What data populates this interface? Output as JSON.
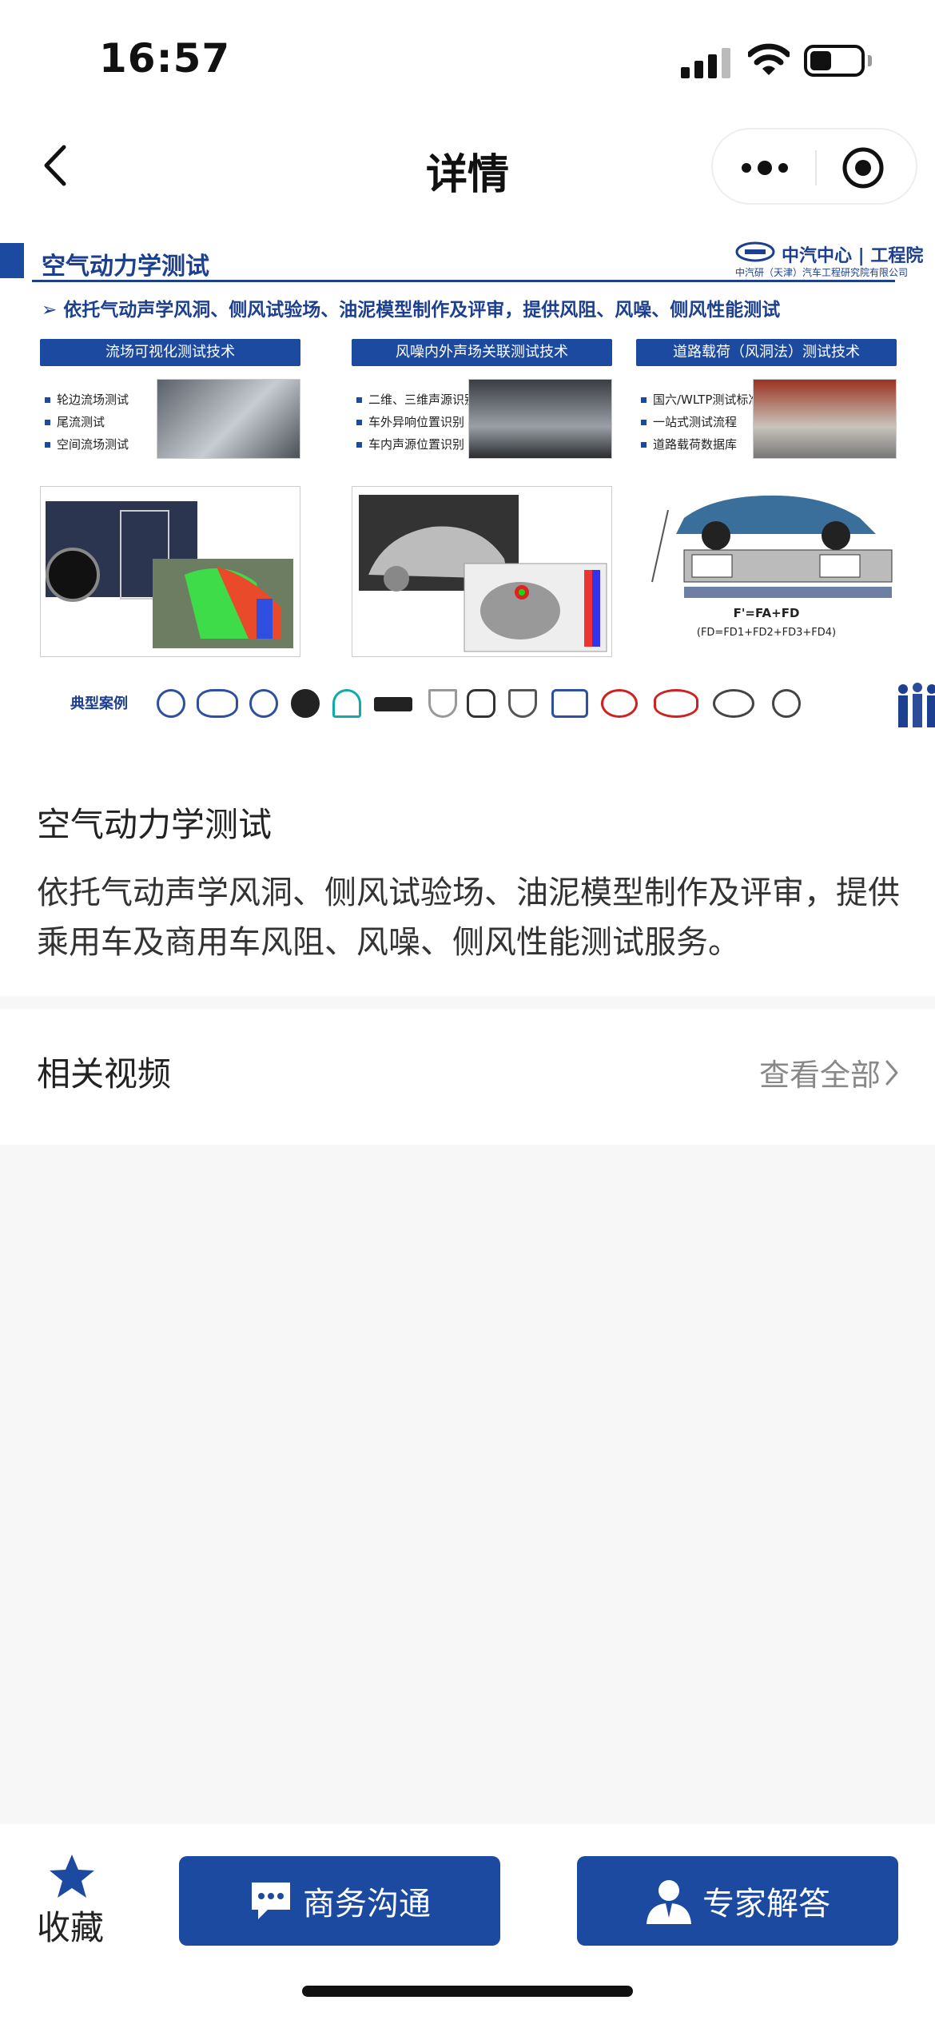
{
  "status_bar": {
    "time": "16:57"
  },
  "nav": {
    "title": "详情"
  },
  "banner": {
    "title": "空气动力学测试",
    "logo_text": "中汽中心 | 工程院",
    "logo_sub": "中汽研（天津）汽车工程研究院有限公司",
    "subtitle": "➢ 依托气动声学风洞、侧风试验场、油泥模型制作及评审，提供风阻、风噪、侧风性能测试",
    "columns": [
      {
        "header": "流场可视化测试技术",
        "items": [
          "轮边流场测试",
          "尾流测试",
          "空间流场测试"
        ]
      },
      {
        "header": "风噪内外声场关联测试技术",
        "items": [
          "二维、三维声源识别",
          "车外异响位置识别",
          "车内声源位置识别"
        ]
      },
      {
        "header": "道路载荷（风洞法）测试技术",
        "items": [
          "国六/WLTP测试标准",
          "一站式测试流程",
          "道路载荷数据库"
        ]
      }
    ],
    "formula_main": "F'=FA+FD",
    "formula_sub": "(FD=FD1+FD2+FD3+FD4)",
    "brand_label": "典型案例"
  },
  "content": {
    "title": "空气动力学测试",
    "description": "依托气动声学风洞、侧风试验场、油泥模型制作及评审，提供乘用车及商用车风阻、风噪、侧风性能测试服务。"
  },
  "related": {
    "title": "相关视频",
    "view_all": "查看全部"
  },
  "bottom": {
    "favorite_label": "收藏",
    "business_label": "商务沟通",
    "expert_label": "专家解答"
  },
  "colors": {
    "primary": "#1c4aa0",
    "background": "#f7f7f7"
  }
}
